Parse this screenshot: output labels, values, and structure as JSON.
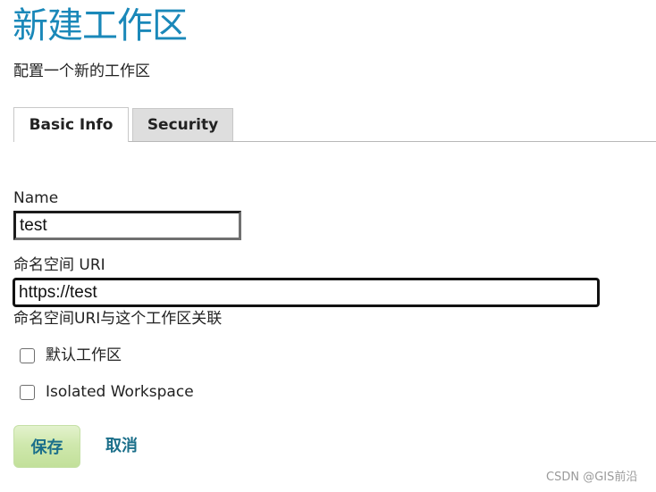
{
  "header": {
    "title": "新建工作区",
    "subtitle": "配置一个新的工作区"
  },
  "tabs": [
    {
      "label": "Basic Info",
      "active": true
    },
    {
      "label": "Security",
      "active": false
    }
  ],
  "form": {
    "name": {
      "label": "Name",
      "value": "test"
    },
    "uri": {
      "label": "命名空间 URI",
      "value": "https://test",
      "help": "命名空间URI与这个工作区关联"
    },
    "checkboxes": [
      {
        "label": "默认工作区",
        "checked": false
      },
      {
        "label": "Isolated Workspace",
        "checked": false
      }
    ]
  },
  "actions": {
    "save_label": "保存",
    "cancel_label": "取消"
  },
  "watermark": "CSDN @GIS前沿",
  "colors": {
    "title": "#1a88b9",
    "link": "#1b6f8a",
    "save_bg": "#c2e09a"
  }
}
